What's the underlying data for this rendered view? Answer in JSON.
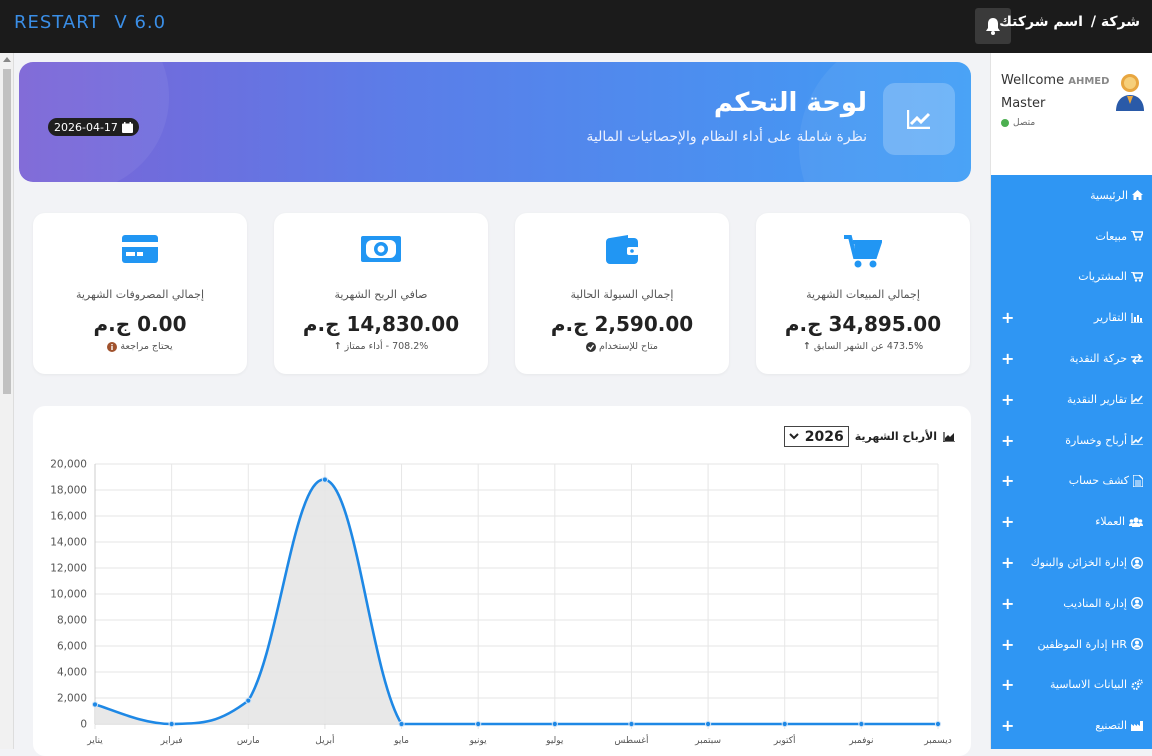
{
  "topbar": {
    "brand": "RESTART",
    "version": "V 6.0",
    "company_prefix": "شركة /",
    "company_name": "اسم شركتك"
  },
  "user": {
    "welcome": "Wellcome",
    "name": "AHMED",
    "role": "Master",
    "status": "متصل"
  },
  "nav": [
    {
      "label": "الرئيسية",
      "icon": "home-icon",
      "expand": ""
    },
    {
      "label": "مبيعات",
      "icon": "cart-icon",
      "expand": ""
    },
    {
      "label": "المشتريات",
      "icon": "cart-plus-icon",
      "expand": ""
    },
    {
      "label": "التقارير",
      "icon": "bar-chart-icon",
      "expand": "+"
    },
    {
      "label": "حركة النقدية",
      "icon": "exchange-icon",
      "expand": "+"
    },
    {
      "label": "تقارير النقدية",
      "icon": "line-chart-icon",
      "expand": "+"
    },
    {
      "label": "أرباح وخسارة",
      "icon": "line-chart-icon",
      "expand": "+"
    },
    {
      "label": "كشف حساب",
      "icon": "file-icon",
      "expand": "+"
    },
    {
      "label": "العملاء",
      "icon": "users-icon",
      "expand": "+"
    },
    {
      "label": "إدارة الخزائن والبنوك",
      "icon": "user-circle-icon",
      "expand": "+"
    },
    {
      "label": "إدارة المناديب",
      "icon": "user-circle-icon",
      "expand": "+"
    },
    {
      "label": "HR إدارة الموظفين",
      "icon": "user-circle-icon",
      "expand": "+"
    },
    {
      "label": "البيانات الاساسية",
      "icon": "cogs-icon",
      "expand": "+"
    },
    {
      "label": "التصنيع",
      "icon": "industry-icon",
      "expand": "+"
    }
  ],
  "hero": {
    "title": "لوحة التحكم",
    "subtitle": "نظرة شاملة على أداء النظام والإحصائيات المالية",
    "date": "2026-04-17"
  },
  "cards": [
    {
      "label": "إجمالي المبيعات الشهرية",
      "value": "34,895.00 ج.م",
      "note": "473.5% عن الشهر السابق",
      "icon": "shopping-cart-icon"
    },
    {
      "label": "إجمالي السيولة الحالية",
      "value": "2,590.00 ج.م",
      "note": "متاح للإستخدام",
      "icon": "wallet-icon"
    },
    {
      "label": "صافي الربح الشهرية",
      "value": "14,830.00 ج.م",
      "note": "708.2% - أداء ممتاز",
      "icon": "money-icon"
    },
    {
      "label": "إجمالي المصروفات الشهرية",
      "value": "0.00 ج.م",
      "note": "يحتاج مراجعة",
      "icon": "credit-card-icon"
    }
  ],
  "chart_header": {
    "title": "الأرباح الشهرية",
    "year": "2026"
  },
  "chart_data": {
    "type": "area",
    "categories": [
      "يناير",
      "فبراير",
      "مارس",
      "أبريل",
      "مايو",
      "يونيو",
      "يوليو",
      "أغسطس",
      "سبتمبر",
      "أكتوبر",
      "نوفمبر",
      "ديسمبر"
    ],
    "series": [
      {
        "values": [
          1500,
          0,
          1800,
          18800,
          0,
          0,
          0,
          0,
          0,
          0,
          0,
          0
        ]
      }
    ],
    "ylim": [
      0,
      20000
    ],
    "yticks": [
      "0",
      "2,000",
      "4,000",
      "6,000",
      "8,000",
      "10,000",
      "12,000",
      "14,000",
      "16,000",
      "18,000",
      "20,000"
    ],
    "grid": true,
    "line_color": "#1e88e5",
    "fill_color": "#e5e5e5"
  }
}
